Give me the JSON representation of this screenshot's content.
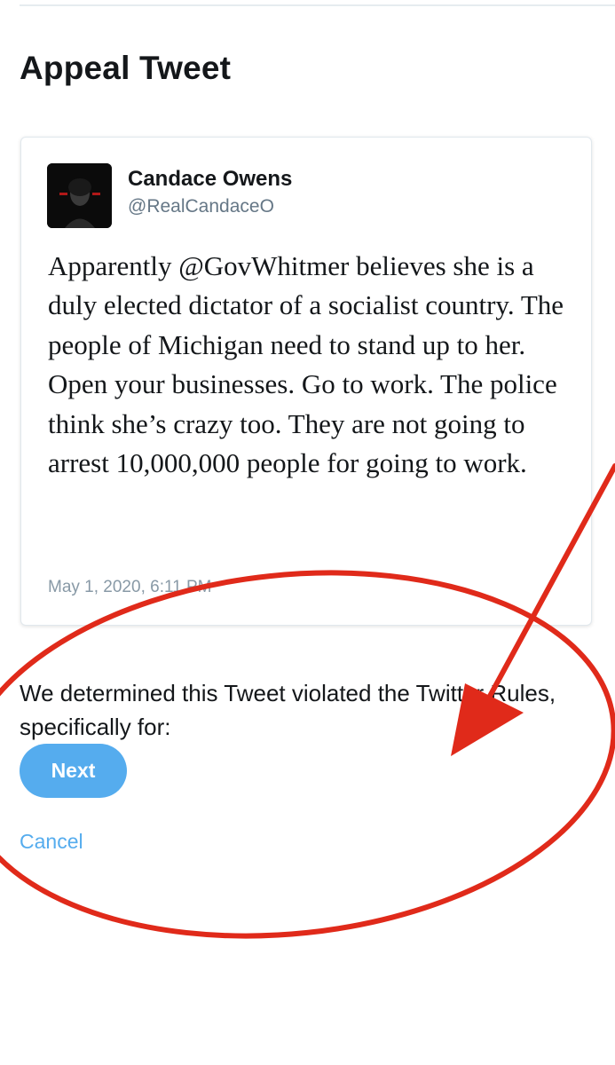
{
  "page": {
    "title": "Appeal Tweet"
  },
  "tweet": {
    "author_name": "Candace Owens",
    "author_handle": "@RealCandaceO",
    "text": "Apparently @GovWhitmer believes she is a duly elected dictator of a socialist country. The people of Michigan need to stand up to her. Open your businesses. Go to work. The police think she’s crazy too. They are not going to arrest 10,000,000 people for going to work.",
    "date": "May 1, 2020, 6:11 PM"
  },
  "appeal": {
    "violation_message": "We determined this Tweet violated the Twitter Rules, specifically for:",
    "next_label": "Next",
    "cancel_label": "Cancel"
  },
  "colors": {
    "accent": "#55acee",
    "annotation_red": "#e02a1a"
  },
  "icons": {
    "avatar": "profile-photo"
  }
}
